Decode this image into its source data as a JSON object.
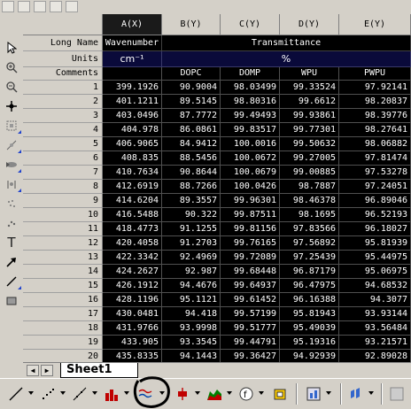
{
  "columns": [
    "A(X)",
    "B(Y)",
    "C(Y)",
    "D(Y)",
    "E(Y)"
  ],
  "row_labels": {
    "long_name": "Long Name",
    "units": "Units",
    "comments": "Comments"
  },
  "long_names": {
    "a": "Wavenumber",
    "transmittance": "Transmittance"
  },
  "units": {
    "a": "cm⁻¹",
    "transmittance": "%"
  },
  "comments": {
    "b": "DOPC",
    "c": "DOMP",
    "d": "WPU",
    "e": "PWPU"
  },
  "rows": [
    {
      "n": "1",
      "a": "399.1926",
      "b": "90.9004",
      "c": "98.03499",
      "d": "99.33524",
      "e": "97.92141"
    },
    {
      "n": "2",
      "a": "401.1211",
      "b": "89.5145",
      "c": "98.80316",
      "d": "99.6612",
      "e": "98.20837"
    },
    {
      "n": "3",
      "a": "403.0496",
      "b": "87.7772",
      "c": "99.49493",
      "d": "99.93861",
      "e": "98.39776"
    },
    {
      "n": "4",
      "a": "404.978",
      "b": "86.0861",
      "c": "99.83517",
      "d": "99.77301",
      "e": "98.27641"
    },
    {
      "n": "5",
      "a": "406.9065",
      "b": "84.9412",
      "c": "100.0016",
      "d": "99.50632",
      "e": "98.06882"
    },
    {
      "n": "6",
      "a": "408.835",
      "b": "88.5456",
      "c": "100.0672",
      "d": "99.27005",
      "e": "97.81474"
    },
    {
      "n": "7",
      "a": "410.7634",
      "b": "90.8644",
      "c": "100.0679",
      "d": "99.00885",
      "e": "97.53278"
    },
    {
      "n": "8",
      "a": "412.6919",
      "b": "88.7266",
      "c": "100.0426",
      "d": "98.7887",
      "e": "97.24051"
    },
    {
      "n": "9",
      "a": "414.6204",
      "b": "89.3557",
      "c": "99.96301",
      "d": "98.46378",
      "e": "96.89046"
    },
    {
      "n": "10",
      "a": "416.5488",
      "b": "90.322",
      "c": "99.87511",
      "d": "98.1695",
      "e": "96.52193"
    },
    {
      "n": "11",
      "a": "418.4773",
      "b": "91.1255",
      "c": "99.81156",
      "d": "97.83566",
      "e": "96.18027"
    },
    {
      "n": "12",
      "a": "420.4058",
      "b": "91.2703",
      "c": "99.76165",
      "d": "97.56892",
      "e": "95.81939"
    },
    {
      "n": "13",
      "a": "422.3342",
      "b": "92.4969",
      "c": "99.72089",
      "d": "97.25439",
      "e": "95.44975"
    },
    {
      "n": "14",
      "a": "424.2627",
      "b": "92.987",
      "c": "99.68448",
      "d": "96.87179",
      "e": "95.06975"
    },
    {
      "n": "15",
      "a": "426.1912",
      "b": "94.4676",
      "c": "99.64937",
      "d": "96.47975",
      "e": "94.68532"
    },
    {
      "n": "16",
      "a": "428.1196",
      "b": "95.1121",
      "c": "99.61452",
      "d": "96.16388",
      "e": "94.3077"
    },
    {
      "n": "17",
      "a": "430.0481",
      "b": "94.418",
      "c": "99.57199",
      "d": "95.81943",
      "e": "93.93144"
    },
    {
      "n": "18",
      "a": "431.9766",
      "b": "93.9998",
      "c": "99.51777",
      "d": "95.49039",
      "e": "93.56484"
    },
    {
      "n": "19",
      "a": "433.905",
      "b": "93.3545",
      "c": "99.44791",
      "d": "95.19316",
      "e": "93.21571"
    },
    {
      "n": "20",
      "a": "435.8335",
      "b": "94.1443",
      "c": "99.36427",
      "d": "94.92939",
      "e": "92.89028"
    }
  ],
  "sheet_tab": "Sheet1",
  "left_tools": [
    "pointer-icon",
    "zoom-in-icon",
    "zoom-out-icon",
    "crosshair-icon",
    "scale-icon",
    "screen-reader-icon",
    "data-reader-icon",
    "data-selector-icon",
    "mask-icon",
    "draw-data-icon",
    "text-tool-icon",
    "arrow-tool-icon",
    "line-tool-icon",
    "rectangle-tool-icon"
  ],
  "colors": {
    "selected_header": "#1a1a1a",
    "data_bg": "#000000",
    "units_bg": "#0a0a3a",
    "highlight_circle": "#000000"
  }
}
